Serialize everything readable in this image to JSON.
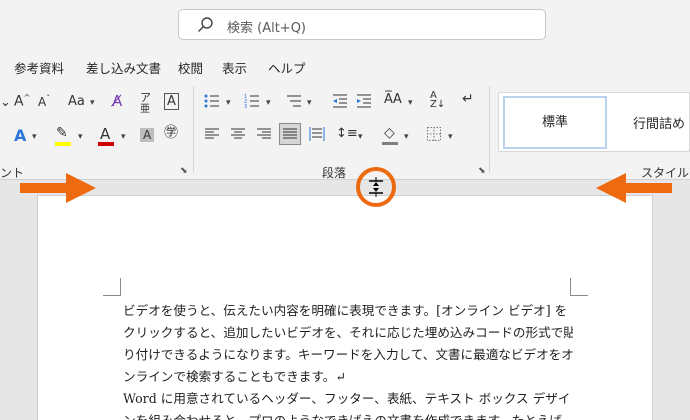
{
  "search": {
    "placeholder": "検索 (Alt+Q)"
  },
  "menu": {
    "tabs": [
      "参考資料",
      "差し込み文書",
      "校閲",
      "表示",
      "ヘルプ"
    ]
  },
  "ribbon": {
    "font_group_label": "ント",
    "paragraph_group_label": "段落",
    "styles_group_label": "スタイル",
    "styles": [
      "標準",
      "行間詰め"
    ]
  },
  "document": {
    "lines": [
      "ビデオを使うと、伝えたい内容を明確に表現できます。[オンライン ビデオ] を",
      "クリックすると、追加したいビデオを、それに応じた埋め込みコードの形式で貼",
      "り付けできるようになります。キーワードを入力して、文書に最適なビデオをオ",
      "ンラインで検索することもできます。↵",
      "Word に用意されているヘッダー、フッター、表紙、テキスト ボックス デザイ",
      "ンを組み合わせると、プロのようなできばえの文書を作成できます。たとえば、"
    ]
  },
  "colors": {
    "annotation": "#ee6a10",
    "font_highlight": "#ffff00",
    "font_color": "#d00000",
    "text_effect": "#2e75d8"
  }
}
